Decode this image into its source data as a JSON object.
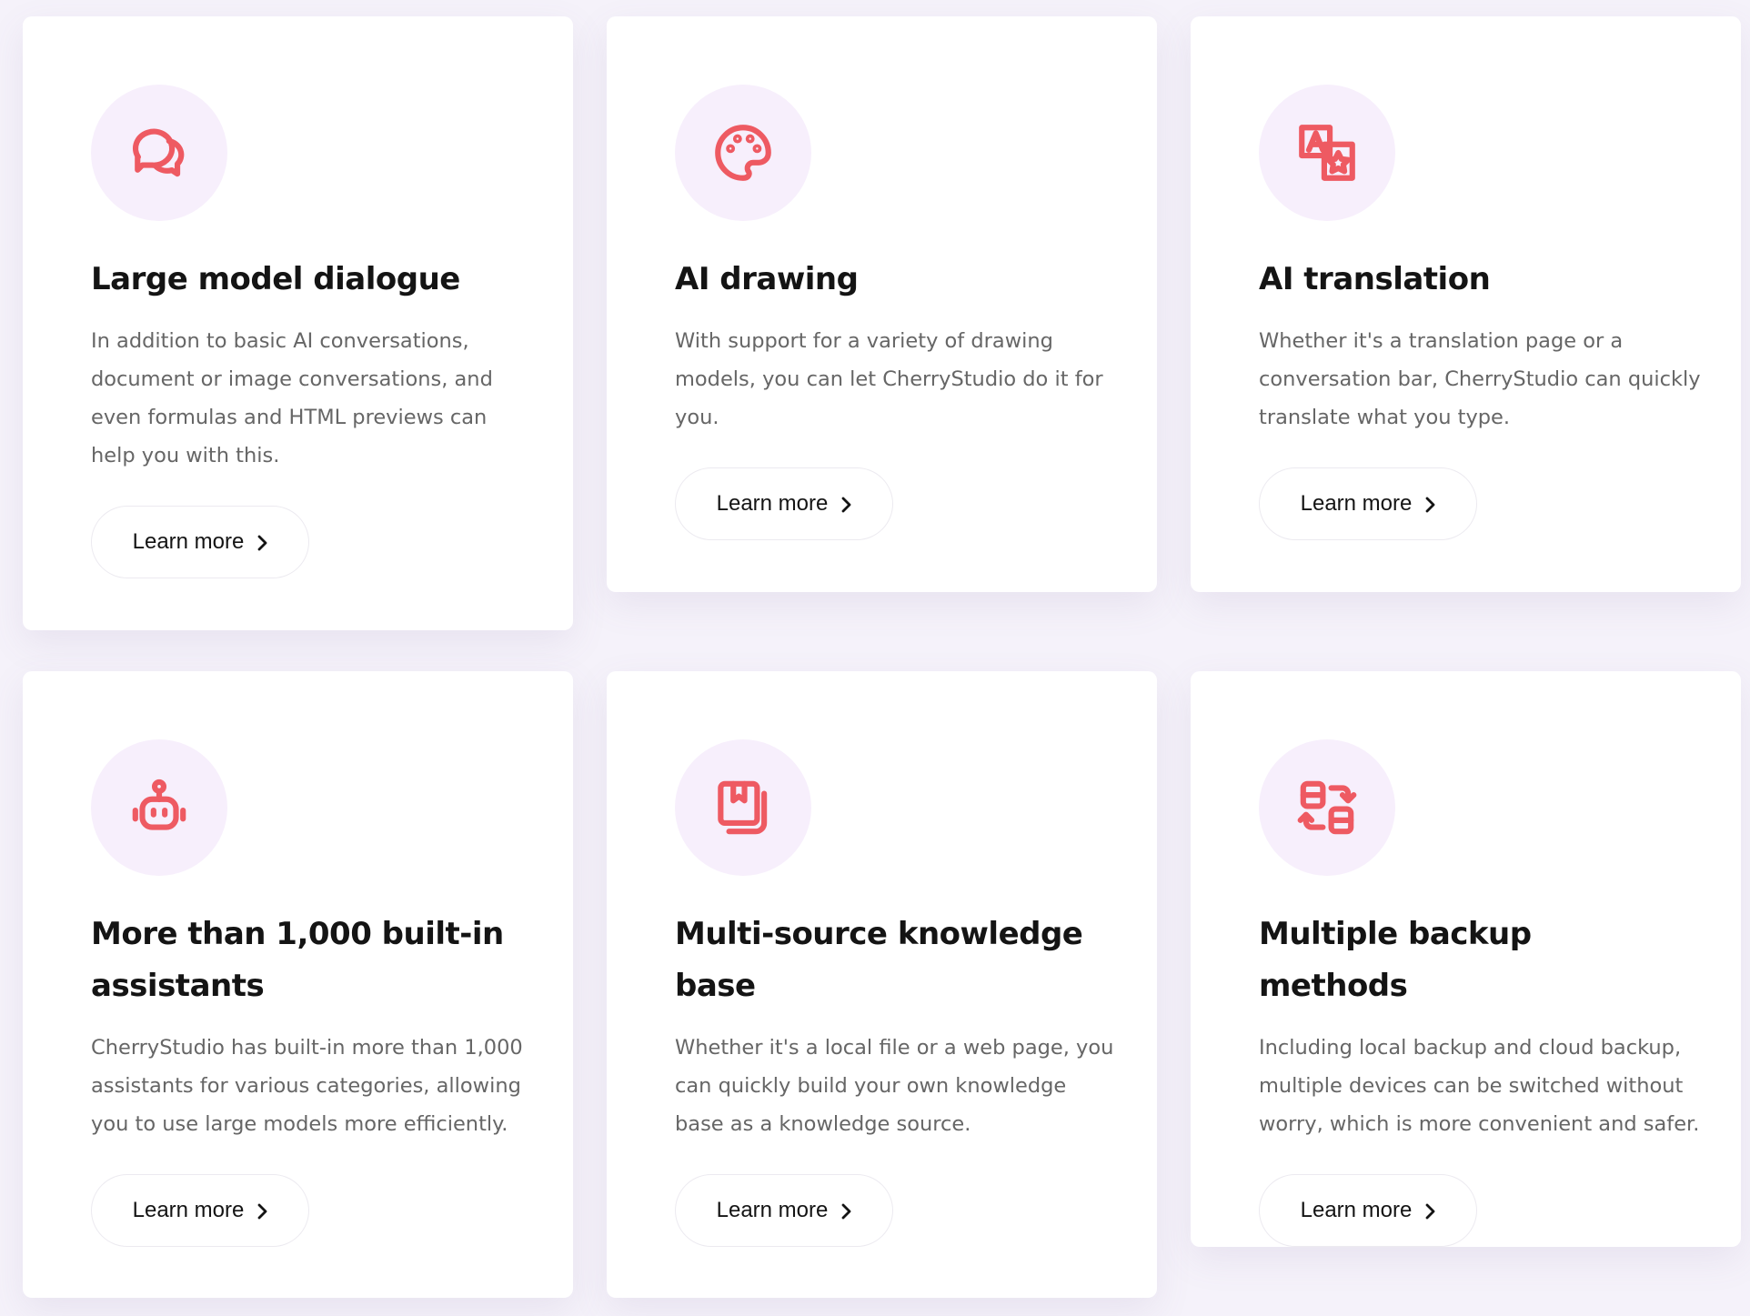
{
  "cards": [
    {
      "icon": "chat-bubbles-icon",
      "title": "Large model dialogue",
      "description": "In addition to basic AI conversations, document or image conversations, and even formulas and HTML previews can help you with this.",
      "button": "Learn more"
    },
    {
      "icon": "palette-icon",
      "title": "AI drawing",
      "description": "With support for a variety of drawing models, you can let CherryStudio do it for you.",
      "button": "Learn more"
    },
    {
      "icon": "translate-icon",
      "title": "AI translation",
      "description": "Whether it's a translation page or a conversation bar, CherryStudio can quickly translate what you type.",
      "button": "Learn more"
    },
    {
      "icon": "robot-icon",
      "title": "More than 1,000 built-in assistants",
      "description": "CherryStudio has built-in more than 1,000 assistants for various categories, allowing you to use large models more efficiently.",
      "button": "Learn more"
    },
    {
      "icon": "bookmark-books-icon",
      "title": "Multi-source knowledge base",
      "description": "Whether it's a local file or a web page, you can quickly build your own knowledge base as a knowledge source.",
      "button": "Learn more"
    },
    {
      "icon": "backup-sync-icon",
      "title": "Multiple backup methods",
      "description": "Including local backup and cloud backup, multiple devices can be switched without worry, which is more convenient and safer.",
      "button": "Learn more"
    }
  ],
  "colors": {
    "accent": "#ee5a62",
    "icon_bg": "#f7effc",
    "page_bg": "#f5f2fa"
  }
}
